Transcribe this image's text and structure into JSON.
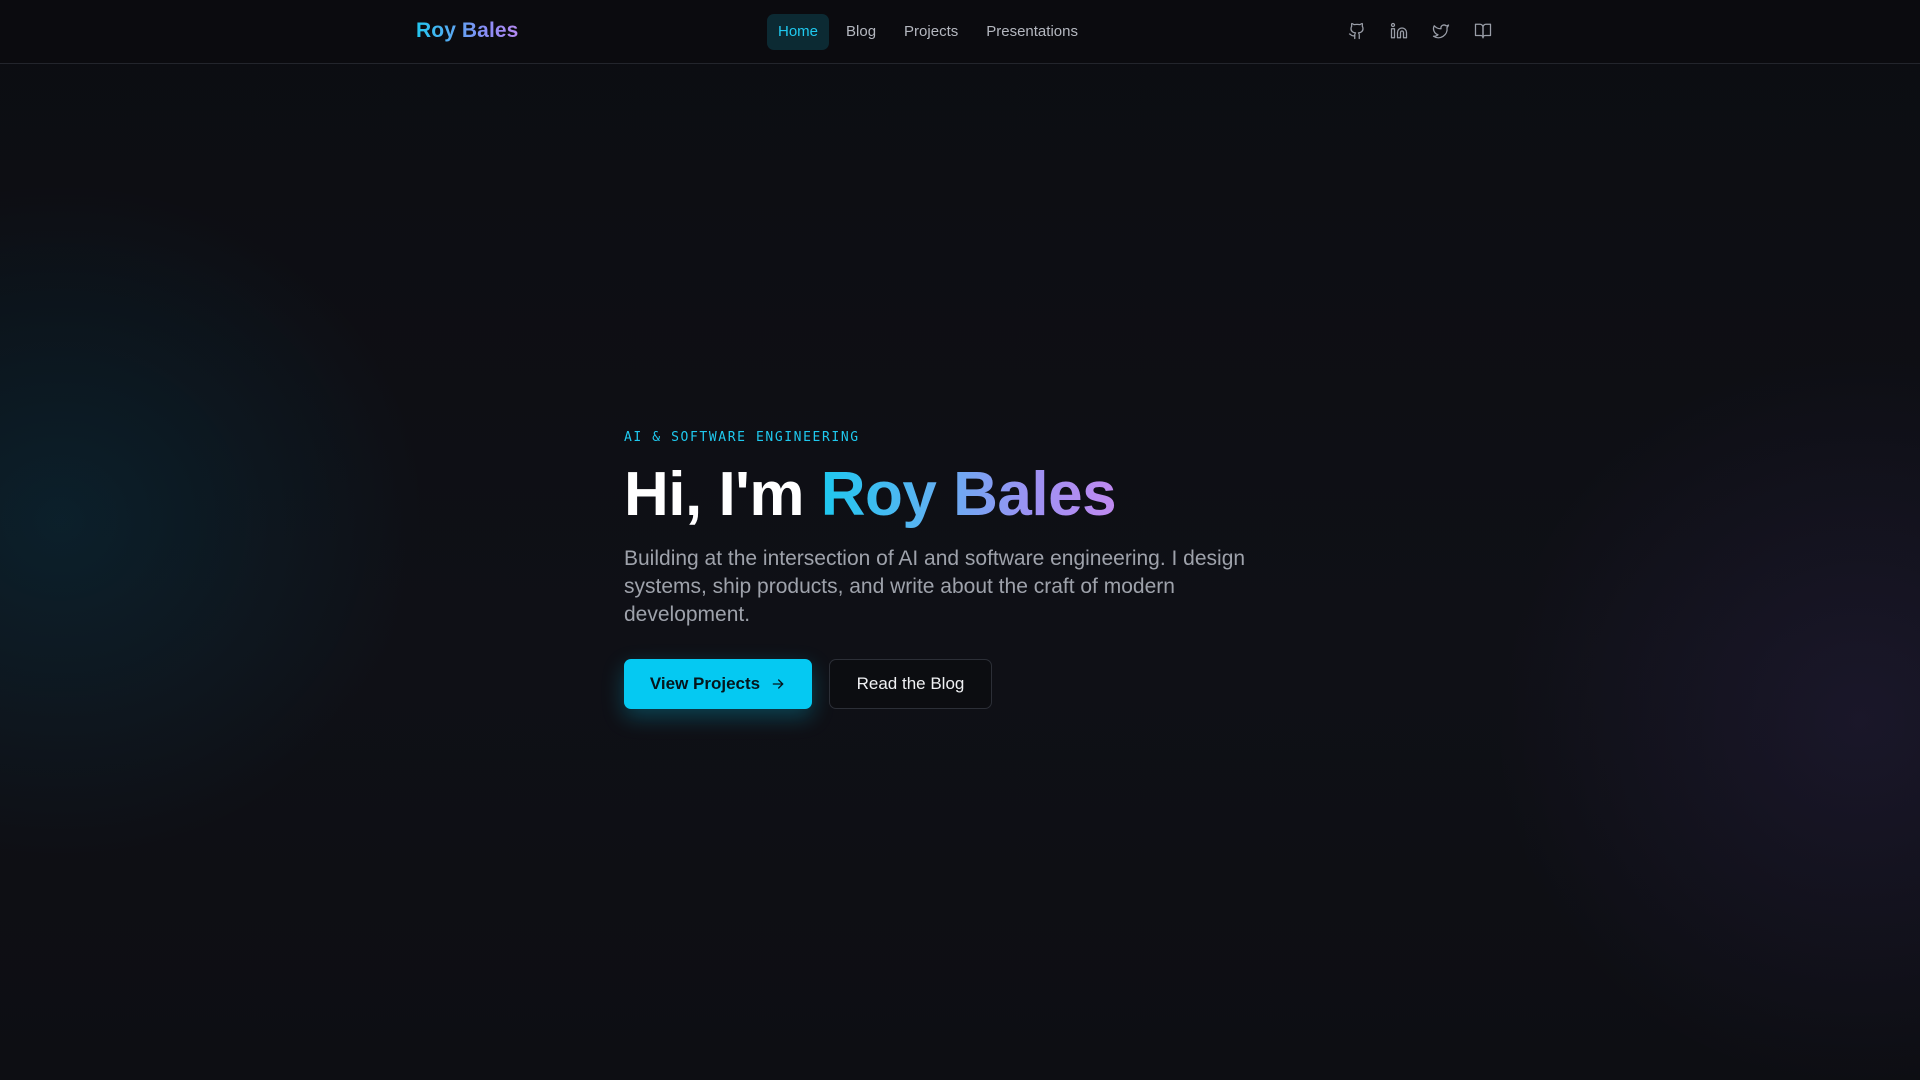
{
  "nav": {
    "brand": "Roy Bales",
    "links": [
      {
        "label": "Home",
        "active": true
      },
      {
        "label": "Blog",
        "active": false
      },
      {
        "label": "Projects",
        "active": false
      },
      {
        "label": "Presentations",
        "active": false
      }
    ],
    "icons": [
      "github-icon",
      "linkedin-icon",
      "twitter-icon",
      "book-icon"
    ]
  },
  "hero": {
    "eyebrow": "AI & SOFTWARE ENGINEERING",
    "greeting": "Hi, I'm ",
    "name": "Roy Bales",
    "lede": "Building at the intersection of AI and software engineering. I design systems, ship products, and write about the craft of modern development.",
    "primary_cta": "View Projects",
    "secondary_cta": "Read the Blog"
  },
  "colors": {
    "accent": "#05c9f2",
    "gradient_end": "#c08af0",
    "background": "#0e0f14"
  }
}
